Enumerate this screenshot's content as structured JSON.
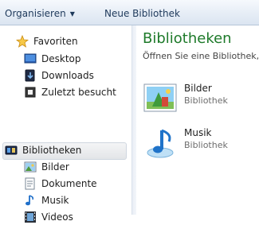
{
  "toolbar": {
    "organize_label": "Organisieren",
    "new_library_label": "Neue Bibliothek"
  },
  "nav": {
    "favorites": {
      "label": "Favoriten",
      "items": [
        {
          "label": "Desktop"
        },
        {
          "label": "Downloads"
        },
        {
          "label": "Zuletzt besucht"
        }
      ]
    },
    "libraries": {
      "label": "Bibliotheken",
      "items": [
        {
          "label": "Bilder"
        },
        {
          "label": "Dokumente"
        },
        {
          "label": "Musik"
        },
        {
          "label": "Videos"
        }
      ]
    }
  },
  "content": {
    "title": "Bibliotheken",
    "subtitle": "Öffnen Sie eine Bibliothek, u",
    "libraries": [
      {
        "name": "Bilder",
        "type": "Bibliothek",
        "icon": "pictures-library-icon"
      },
      {
        "name": "Musik",
        "type": "Bibliothek",
        "icon": "music-library-icon"
      }
    ]
  },
  "colors": {
    "title_green": "#1e7a2a",
    "toolbar_text": "#1e395b"
  }
}
